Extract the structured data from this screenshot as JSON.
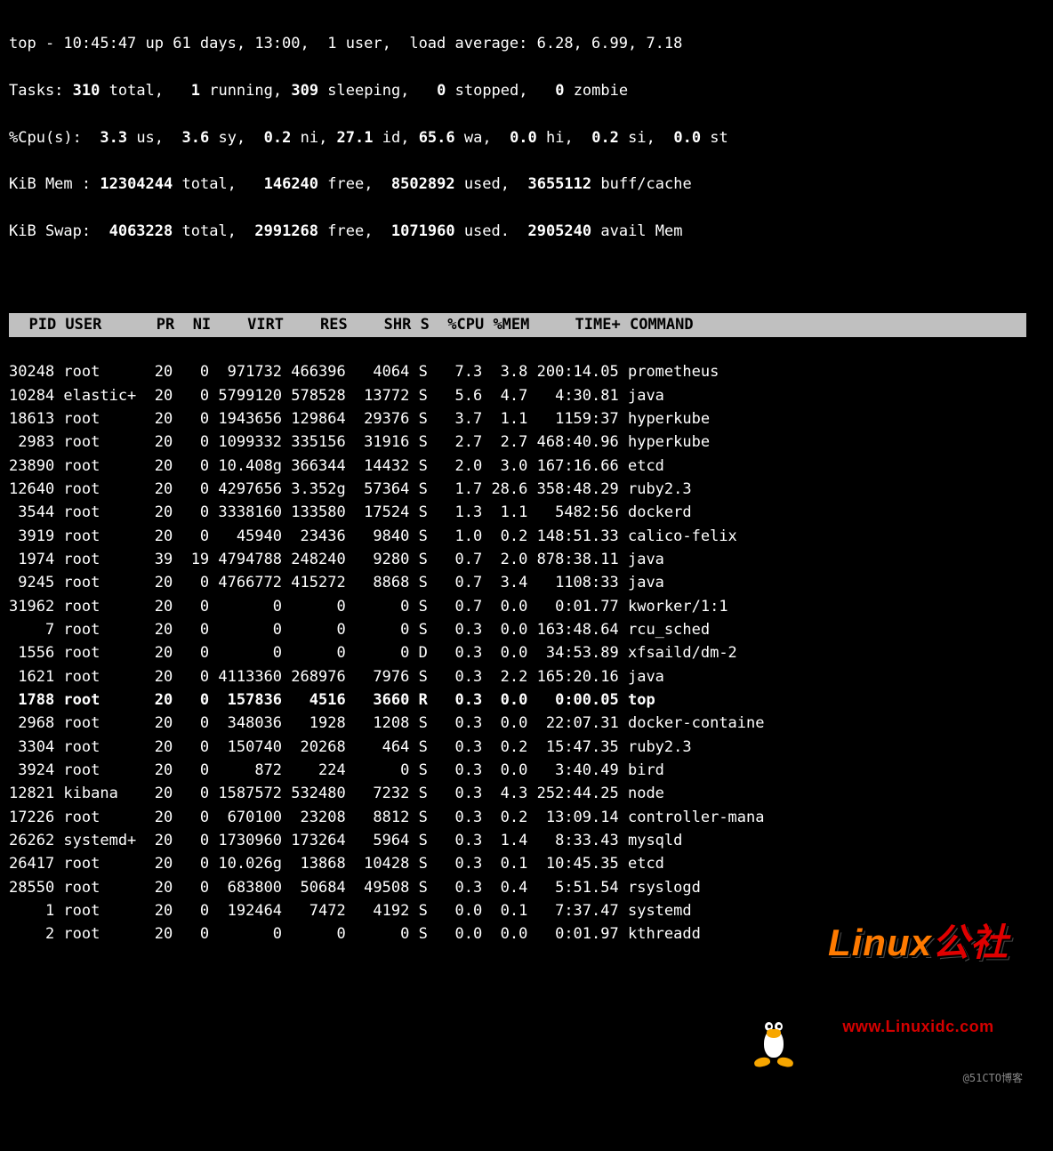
{
  "summary": {
    "line1_a": "top - 10:45:47 up 61 days, 13:00,  1 user,  load average: 6.28, 6.99, 7.18",
    "tasks": {
      "prefix": "Tasks: ",
      "total": "310",
      "l_total": " total,   ",
      "running": "1",
      "l_running": " running, ",
      "sleeping": "309",
      "l_sleeping": " sleeping,   ",
      "stopped": "0",
      "l_stopped": " stopped,   ",
      "zombie": "0",
      "l_zombie": " zombie"
    },
    "cpu": {
      "prefix": "%Cpu(s):  ",
      "us": "3.3",
      "l_us": " us,  ",
      "sy": "3.6",
      "l_sy": " sy,  ",
      "ni": "0.2",
      "l_ni": " ni, ",
      "id": "27.1",
      "l_id": " id, ",
      "wa": "65.6",
      "l_wa": " wa,  ",
      "hi": "0.0",
      "l_hi": " hi,  ",
      "si": "0.2",
      "l_si": " si,  ",
      "st": "0.0",
      "l_st": " st"
    },
    "mem": {
      "prefix": "KiB Mem : ",
      "total": "12304244",
      "l_total": " total,   ",
      "free": "146240",
      "l_free": " free,  ",
      "used": "8502892",
      "l_used": " used,  ",
      "buff": "3655112",
      "l_buff": " buff/cache"
    },
    "swap": {
      "prefix": "KiB Swap:  ",
      "total": "4063228",
      "l_total": " total,  ",
      "free": "2991268",
      "l_free": " free,  ",
      "used": "1071960",
      "l_used": " used.  ",
      "avail": "2905240",
      "l_avail": " avail Mem"
    }
  },
  "columns": "  PID USER      PR  NI    VIRT    RES    SHR S  %CPU %MEM     TIME+ COMMAND        ",
  "rows": [
    {
      "pid": "30248",
      "user": "root    ",
      "pr": "20",
      "ni": "  0",
      "virt": " 971732",
      "res": "466396",
      "shr": "  4064",
      "s": "S",
      "cpu": "  7.3",
      "mem": " 3.8",
      "time": "200:14.05",
      "cmd": "prometheus"
    },
    {
      "pid": "10284",
      "user": "elastic+",
      "pr": "20",
      "ni": "  0",
      "virt": "5799120",
      "res": "578528",
      "shr": " 13772",
      "s": "S",
      "cpu": "  5.6",
      "mem": " 4.7",
      "time": "  4:30.81",
      "cmd": "java"
    },
    {
      "pid": "18613",
      "user": "root    ",
      "pr": "20",
      "ni": "  0",
      "virt": "1943656",
      "res": "129864",
      "shr": " 29376",
      "s": "S",
      "cpu": "  3.7",
      "mem": " 1.1",
      "time": "  1159:37",
      "cmd": "hyperkube"
    },
    {
      "pid": " 2983",
      "user": "root    ",
      "pr": "20",
      "ni": "  0",
      "virt": "1099332",
      "res": "335156",
      "shr": " 31916",
      "s": "S",
      "cpu": "  2.7",
      "mem": " 2.7",
      "time": "468:40.96",
      "cmd": "hyperkube"
    },
    {
      "pid": "23890",
      "user": "root    ",
      "pr": "20",
      "ni": "  0",
      "virt": "10.408g",
      "res": "366344",
      "shr": " 14432",
      "s": "S",
      "cpu": "  2.0",
      "mem": " 3.0",
      "time": "167:16.66",
      "cmd": "etcd"
    },
    {
      "pid": "12640",
      "user": "root    ",
      "pr": "20",
      "ni": "  0",
      "virt": "4297656",
      "res": "3.352g",
      "shr": " 57364",
      "s": "S",
      "cpu": "  1.7",
      "mem": "28.6",
      "time": "358:48.29",
      "cmd": "ruby2.3"
    },
    {
      "pid": " 3544",
      "user": "root    ",
      "pr": "20",
      "ni": "  0",
      "virt": "3338160",
      "res": "133580",
      "shr": " 17524",
      "s": "S",
      "cpu": "  1.3",
      "mem": " 1.1",
      "time": "  5482:56",
      "cmd": "dockerd"
    },
    {
      "pid": " 3919",
      "user": "root    ",
      "pr": "20",
      "ni": "  0",
      "virt": "  45940",
      "res": " 23436",
      "shr": "  9840",
      "s": "S",
      "cpu": "  1.0",
      "mem": " 0.2",
      "time": "148:51.33",
      "cmd": "calico-felix"
    },
    {
      "pid": " 1974",
      "user": "root    ",
      "pr": "39",
      "ni": " 19",
      "virt": "4794788",
      "res": "248240",
      "shr": "  9280",
      "s": "S",
      "cpu": "  0.7",
      "mem": " 2.0",
      "time": "878:38.11",
      "cmd": "java"
    },
    {
      "pid": " 9245",
      "user": "root    ",
      "pr": "20",
      "ni": "  0",
      "virt": "4766772",
      "res": "415272",
      "shr": "  8868",
      "s": "S",
      "cpu": "  0.7",
      "mem": " 3.4",
      "time": "  1108:33",
      "cmd": "java"
    },
    {
      "pid": "31962",
      "user": "root    ",
      "pr": "20",
      "ni": "  0",
      "virt": "      0",
      "res": "     0",
      "shr": "     0",
      "s": "S",
      "cpu": "  0.7",
      "mem": " 0.0",
      "time": "  0:01.77",
      "cmd": "kworker/1:1"
    },
    {
      "pid": "    7",
      "user": "root    ",
      "pr": "20",
      "ni": "  0",
      "virt": "      0",
      "res": "     0",
      "shr": "     0",
      "s": "S",
      "cpu": "  0.3",
      "mem": " 0.0",
      "time": "163:48.64",
      "cmd": "rcu_sched"
    },
    {
      "pid": " 1556",
      "user": "root    ",
      "pr": "20",
      "ni": "  0",
      "virt": "      0",
      "res": "     0",
      "shr": "     0",
      "s": "D",
      "cpu": "  0.3",
      "mem": " 0.0",
      "time": " 34:53.89",
      "cmd": "xfsaild/dm-2"
    },
    {
      "pid": " 1621",
      "user": "root    ",
      "pr": "20",
      "ni": "  0",
      "virt": "4113360",
      "res": "268976",
      "shr": "  7976",
      "s": "S",
      "cpu": "  0.3",
      "mem": " 2.2",
      "time": "165:20.16",
      "cmd": "java"
    },
    {
      "pid": " 1788",
      "user": "root    ",
      "pr": "20",
      "ni": "  0",
      "virt": " 157836",
      "res": "  4516",
      "shr": "  3660",
      "s": "R",
      "cpu": "  0.3",
      "mem": " 0.0",
      "time": "  0:00.05",
      "cmd": "top",
      "bold": true
    },
    {
      "pid": " 2968",
      "user": "root    ",
      "pr": "20",
      "ni": "  0",
      "virt": " 348036",
      "res": "  1928",
      "shr": "  1208",
      "s": "S",
      "cpu": "  0.3",
      "mem": " 0.0",
      "time": " 22:07.31",
      "cmd": "docker-containe"
    },
    {
      "pid": " 3304",
      "user": "root    ",
      "pr": "20",
      "ni": "  0",
      "virt": " 150740",
      "res": " 20268",
      "shr": "   464",
      "s": "S",
      "cpu": "  0.3",
      "mem": " 0.2",
      "time": " 15:47.35",
      "cmd": "ruby2.3"
    },
    {
      "pid": " 3924",
      "user": "root    ",
      "pr": "20",
      "ni": "  0",
      "virt": "    872",
      "res": "   224",
      "shr": "     0",
      "s": "S",
      "cpu": "  0.3",
      "mem": " 0.0",
      "time": "  3:40.49",
      "cmd": "bird"
    },
    {
      "pid": "12821",
      "user": "kibana  ",
      "pr": "20",
      "ni": "  0",
      "virt": "1587572",
      "res": "532480",
      "shr": "  7232",
      "s": "S",
      "cpu": "  0.3",
      "mem": " 4.3",
      "time": "252:44.25",
      "cmd": "node"
    },
    {
      "pid": "17226",
      "user": "root    ",
      "pr": "20",
      "ni": "  0",
      "virt": " 670100",
      "res": " 23208",
      "shr": "  8812",
      "s": "S",
      "cpu": "  0.3",
      "mem": " 0.2",
      "time": " 13:09.14",
      "cmd": "controller-mana"
    },
    {
      "pid": "26262",
      "user": "systemd+",
      "pr": "20",
      "ni": "  0",
      "virt": "1730960",
      "res": "173264",
      "shr": "  5964",
      "s": "S",
      "cpu": "  0.3",
      "mem": " 1.4",
      "time": "  8:33.43",
      "cmd": "mysqld"
    },
    {
      "pid": "26417",
      "user": "root    ",
      "pr": "20",
      "ni": "  0",
      "virt": "10.026g",
      "res": " 13868",
      "shr": " 10428",
      "s": "S",
      "cpu": "  0.3",
      "mem": " 0.1",
      "time": " 10:45.35",
      "cmd": "etcd"
    },
    {
      "pid": "28550",
      "user": "root    ",
      "pr": "20",
      "ni": "  0",
      "virt": " 683800",
      "res": " 50684",
      "shr": " 49508",
      "s": "S",
      "cpu": "  0.3",
      "mem": " 0.4",
      "time": "  5:51.54",
      "cmd": "rsyslogd"
    },
    {
      "pid": "    1",
      "user": "root    ",
      "pr": "20",
      "ni": "  0",
      "virt": " 192464",
      "res": "  7472",
      "shr": "  4192",
      "s": "S",
      "cpu": "  0.0",
      "mem": " 0.1",
      "time": "  7:37.47",
      "cmd": "systemd"
    },
    {
      "pid": "    2",
      "user": "root    ",
      "pr": "20",
      "ni": "  0",
      "virt": "      0",
      "res": "     0",
      "shr": "     0",
      "s": "S",
      "cpu": "  0.0",
      "mem": " 0.0",
      "time": "  0:01.97",
      "cmd": "kthreadd"
    }
  ],
  "watermark": "@51CTO博客",
  "logo": {
    "brand_l": "Linux",
    "brand_r": "公社",
    "url": "www.Linuxidc.com"
  }
}
